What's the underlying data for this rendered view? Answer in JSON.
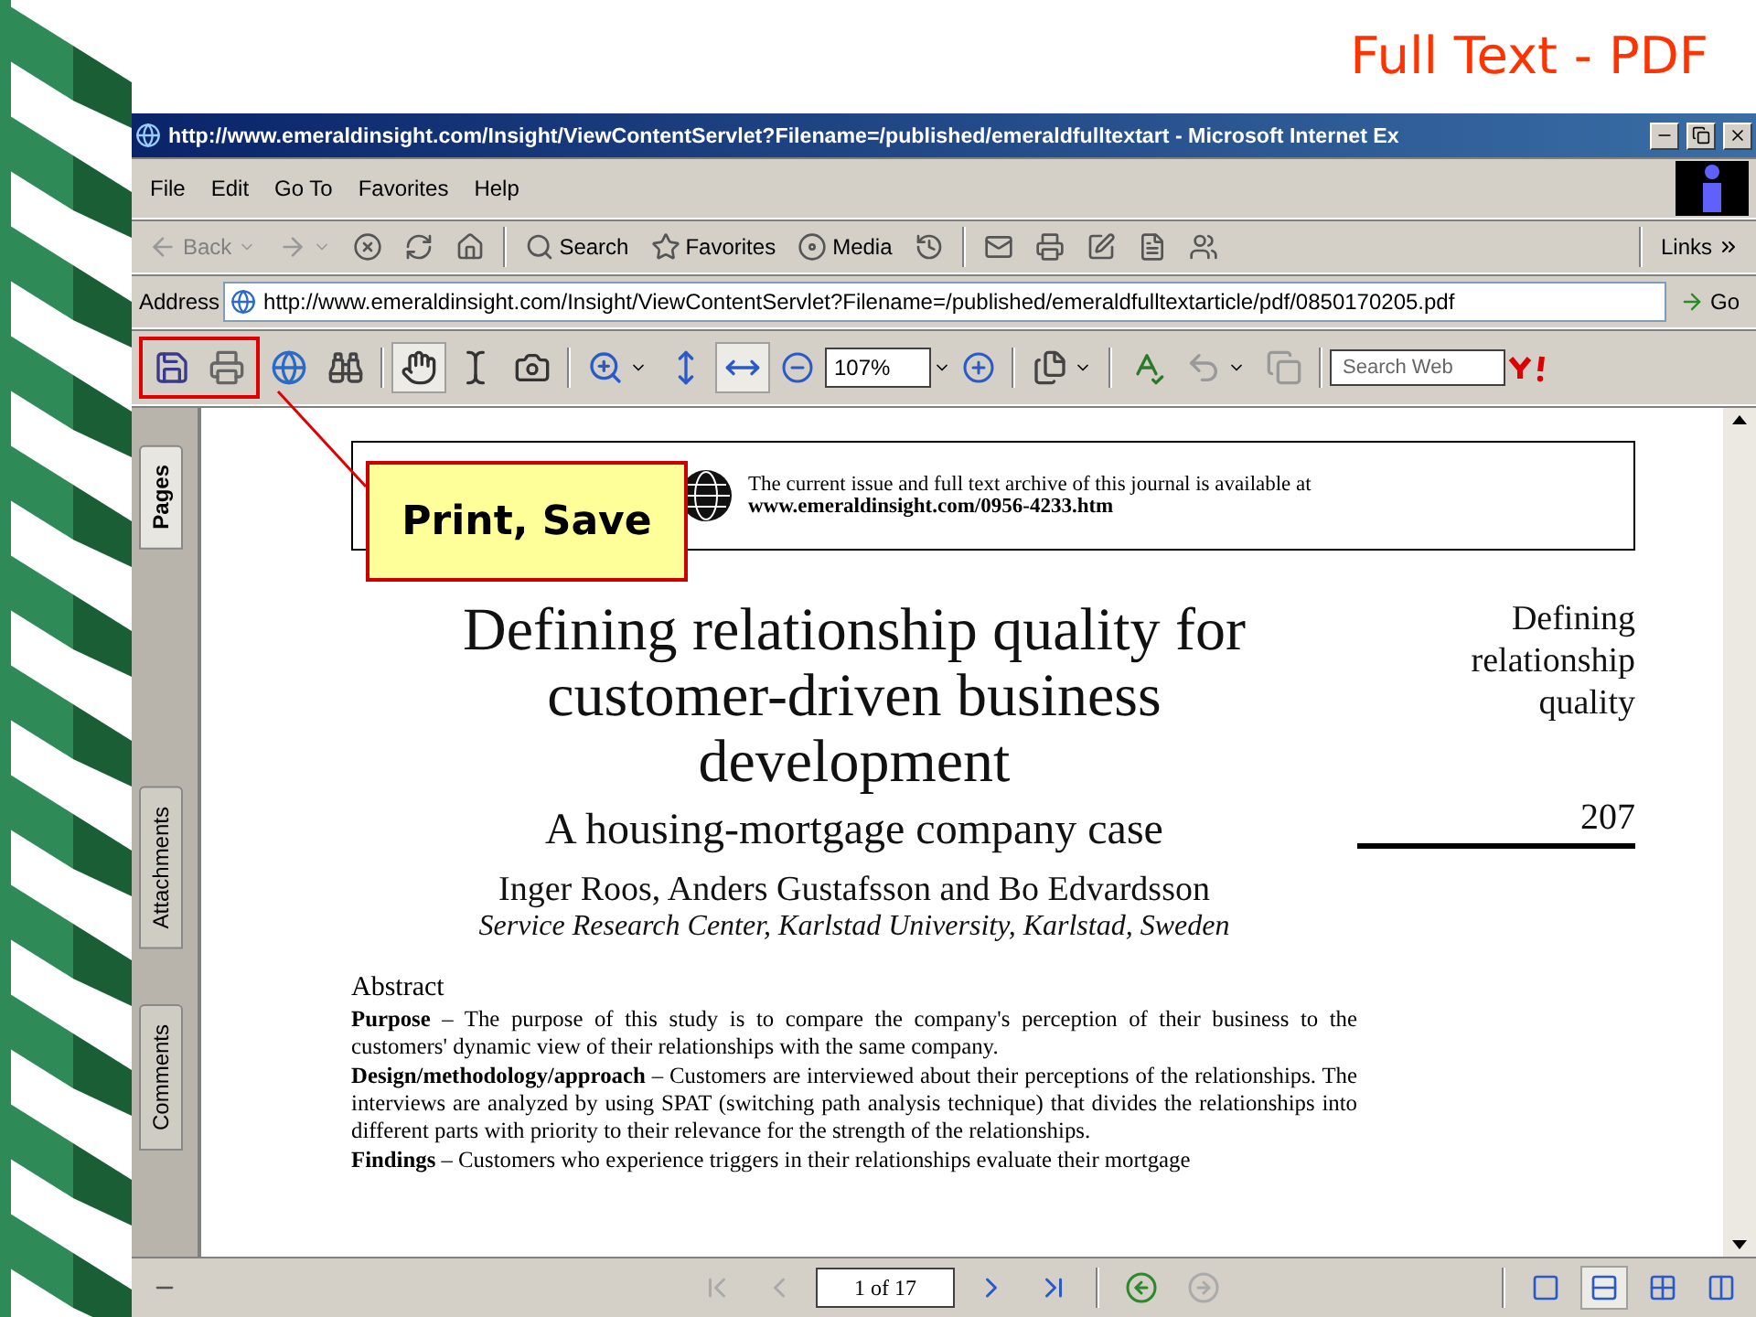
{
  "slide": {
    "title": "Full Text - PDF"
  },
  "window": {
    "title": "http://www.emeraldinsight.com/Insight/ViewContentServlet?Filename=/published/emeraldfulltextart - Microsoft Internet Ex"
  },
  "menu": [
    "File",
    "Edit",
    "Go To",
    "Favorites",
    "Help"
  ],
  "browser_toolbar": {
    "back": "Back",
    "search": "Search",
    "favorites": "Favorites",
    "media": "Media",
    "links": "Links"
  },
  "address": {
    "label": "Address",
    "value": "http://www.emeraldinsight.com/Insight/ViewContentServlet?Filename=/published/emeraldfulltextarticle/pdf/0850170205.pdf",
    "go": "Go"
  },
  "reader_toolbar": {
    "zoom": "107%",
    "search_placeholder": "Search Web"
  },
  "side_tabs": [
    {
      "label": "Pages",
      "selected": true
    },
    {
      "label": "Attachments",
      "selected": false
    },
    {
      "label": "Comments",
      "selected": false
    }
  ],
  "document": {
    "header_lines": [
      "The current issue and full text archive of this journal is available at",
      "www.emeraldinsight.com/0956-4233.htm"
    ],
    "title": "Defining relationship quality for customer-driven business development",
    "subtitle": "A housing-mortgage company case",
    "authors": "Inger Roos, Anders Gustafsson and Bo Edvardsson",
    "affiliation": "Service Research Center, Karlstad University, Karlstad, Sweden",
    "running_head": [
      "Defining",
      "relationship",
      "quality"
    ],
    "page_number": "207",
    "abstract_heading": "Abstract",
    "paragraphs": [
      "**Purpose** – The purpose of this study is to compare the company's perception of their business to the customers' dynamic view of their relationships with the same company.",
      "**Design/methodology/approach** – Customers are interviewed about their perceptions of the relationships. The interviews are analyzed by using SPAT (switching path analysis technique) that divides the relationships into different parts with priority to their relevance for the strength of the relationships.",
      "**Findings** – Customers who experience triggers in their relationships evaluate their mortgage"
    ]
  },
  "navigation": {
    "page": "1 of 17"
  },
  "view_modes": [
    {
      "kind": "single",
      "selected": false
    },
    {
      "kind": "continuous",
      "selected": true
    },
    {
      "kind": "continuous_facing",
      "selected": false
    },
    {
      "kind": "facing",
      "selected": false
    }
  ],
  "callout": {
    "text": "Print, Save"
  }
}
